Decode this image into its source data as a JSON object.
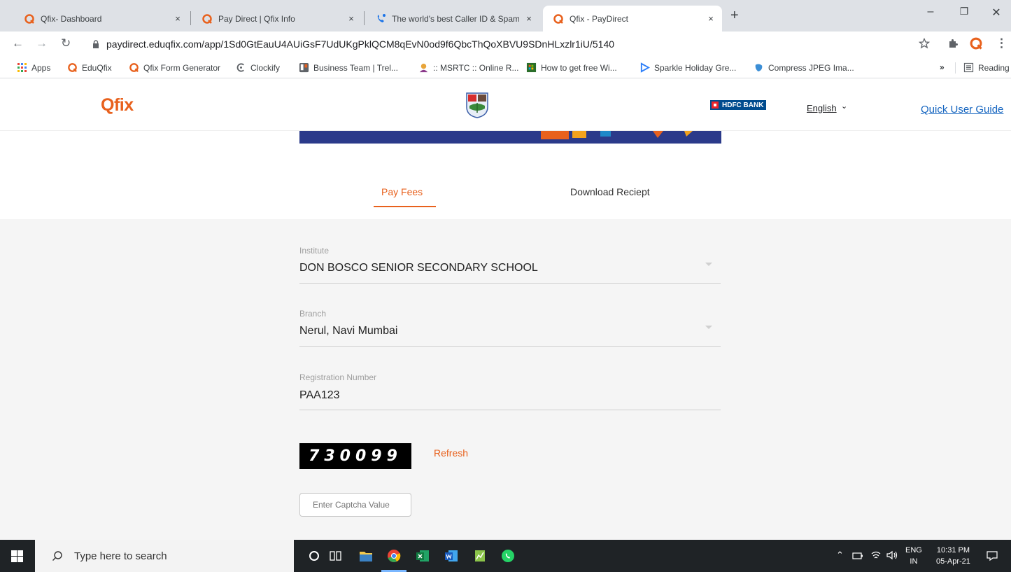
{
  "browser": {
    "tabs": [
      {
        "title": "Qfix- Dashboard",
        "close": "×"
      },
      {
        "title": "Pay Direct | Qfix Info",
        "close": "×"
      },
      {
        "title": "The world's best Caller ID & Spam",
        "close": "×"
      },
      {
        "title": "Qfix - PayDirect",
        "close": "×"
      }
    ],
    "new_tab": "+",
    "window_controls": {
      "minimize": "–",
      "restore": "❐",
      "close": "✕"
    },
    "url": "paydirect.eduqfix.com/app/1Sd0GtEauU4AUiGsF7UdUKgPklQCM8qEvN0od9f6QbcThQoXBVU9SDnHLxzlr1iU/5140",
    "bookmarks": [
      "Apps",
      "EduQfix",
      "Qfix Form Generator",
      "Clockify",
      "Business Team | Trel...",
      ":: MSRTC :: Online R...",
      "How to get free Wi...",
      "Sparkle Holiday Gre...",
      "Compress JPEG Ima..."
    ],
    "more_bookmarks": "»",
    "reading_list": "Reading list"
  },
  "site": {
    "logo": "Qfix",
    "bank_logo": "HDFC BANK",
    "language": "English",
    "quick_guide": "Quick User Guide",
    "tabs": {
      "pay_fees": "Pay Fees",
      "download_receipt": "Download Reciept"
    },
    "form": {
      "institute_label": "Institute",
      "institute_value": "DON BOSCO SENIOR SECONDARY SCHOOL",
      "branch_label": "Branch",
      "branch_value": "Nerul, Navi Mumbai",
      "registration_label": "Registration Number",
      "registration_value": "PAA123",
      "captcha_code": "730099",
      "refresh": "Refresh",
      "captcha_placeholder": "Enter Captcha Value"
    }
  },
  "taskbar": {
    "search_placeholder": "Type here to search",
    "lang_top": "ENG",
    "lang_bottom": "IN",
    "time": "10:31 PM",
    "date": "05-Apr-21"
  },
  "colors": {
    "accent": "#e8611d",
    "brand_blue": "#2b3a8a",
    "link": "#1565c0"
  }
}
